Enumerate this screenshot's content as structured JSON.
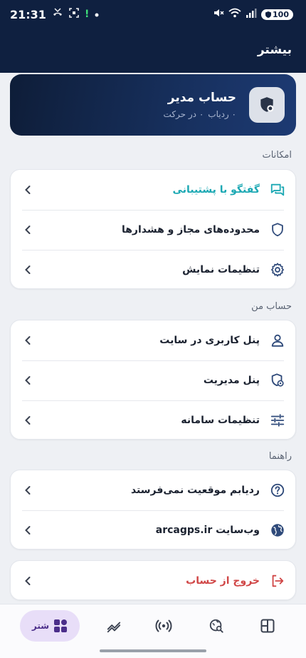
{
  "status": {
    "time": "21:31",
    "battery": "100"
  },
  "header": {
    "title": "بیشتر"
  },
  "admin": {
    "name": "حساب مدیر",
    "trackers": "۰ ردیاب",
    "moving": "۰ در حرکت"
  },
  "sections": {
    "features": {
      "label": "امکانات",
      "items": [
        {
          "label": "گفتگو با پشتیبانی",
          "icon": "chat-icon"
        },
        {
          "label": "محدوده‌های مجاز و هشدارها",
          "icon": "shield-icon"
        },
        {
          "label": "تنظیمات نمایش",
          "icon": "gear-icon"
        }
      ]
    },
    "account": {
      "label": "حساب من",
      "items": [
        {
          "label": "پنل کاربری در سایت",
          "icon": "user-icon"
        },
        {
          "label": "پنل مدیریت",
          "icon": "admin-shield-icon"
        },
        {
          "label": "تنظیمات سامانه",
          "icon": "sliders-icon"
        }
      ]
    },
    "help": {
      "label": "راهنما",
      "items": [
        {
          "label": "ردیابم موقعیت نمی‌فرستد",
          "icon": "question-icon"
        },
        {
          "label": "وب‌سایت arcagps.ir",
          "icon": "globe-icon"
        }
      ]
    },
    "logout": {
      "label": "خروج از حساب",
      "icon": "logout-icon"
    }
  },
  "bottom_nav": {
    "active_label": "شتر"
  },
  "colors": {
    "header_bg": "#0f2040",
    "accent": "#1ba8b3",
    "danger": "#d04646",
    "nav_active_bg": "#e8def8"
  }
}
